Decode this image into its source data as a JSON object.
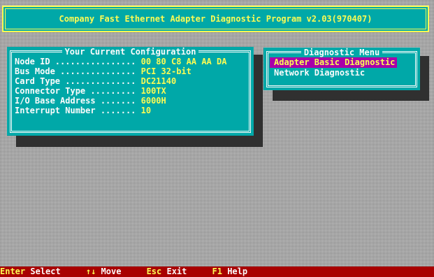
{
  "title": "Company Fast Ethernet Adapter Diagnostic Program v2.03(970407)",
  "config": {
    "heading": "Your Current Configuration",
    "rows": [
      {
        "label": "Node ID ................",
        "value": "00 80 C8 AA AA DA"
      },
      {
        "label": "Bus Mode ...............",
        "value": "PCI 32-bit"
      },
      {
        "label": "Card Type ..............",
        "value": "DC21140"
      },
      {
        "label": "Connector Type .........",
        "value": "100TX"
      },
      {
        "label": "I/O Base Address .......",
        "value": "6000H"
      },
      {
        "label": "Interrupt Number .......",
        "value": "10"
      }
    ]
  },
  "menu": {
    "heading": "Diagnostic Menu",
    "items": [
      {
        "label": "Adapter Basic Diagnostic",
        "selected": true
      },
      {
        "label": "Network Diagnostic",
        "selected": false
      }
    ]
  },
  "status": {
    "select_key": "Enter",
    "select_label": "Select",
    "move_key": "↑↓",
    "move_label": "Move",
    "exit_key": "Esc",
    "exit_label": "Exit",
    "help_key": "F1",
    "help_label": "Help"
  },
  "colors": {
    "background": "#a8a8a8",
    "panel": "#00a8a8",
    "highlight": "#a800a8",
    "status_bar": "#a80000",
    "text_yellow": "#fcfc54",
    "text_white": "#fcfcfc"
  }
}
